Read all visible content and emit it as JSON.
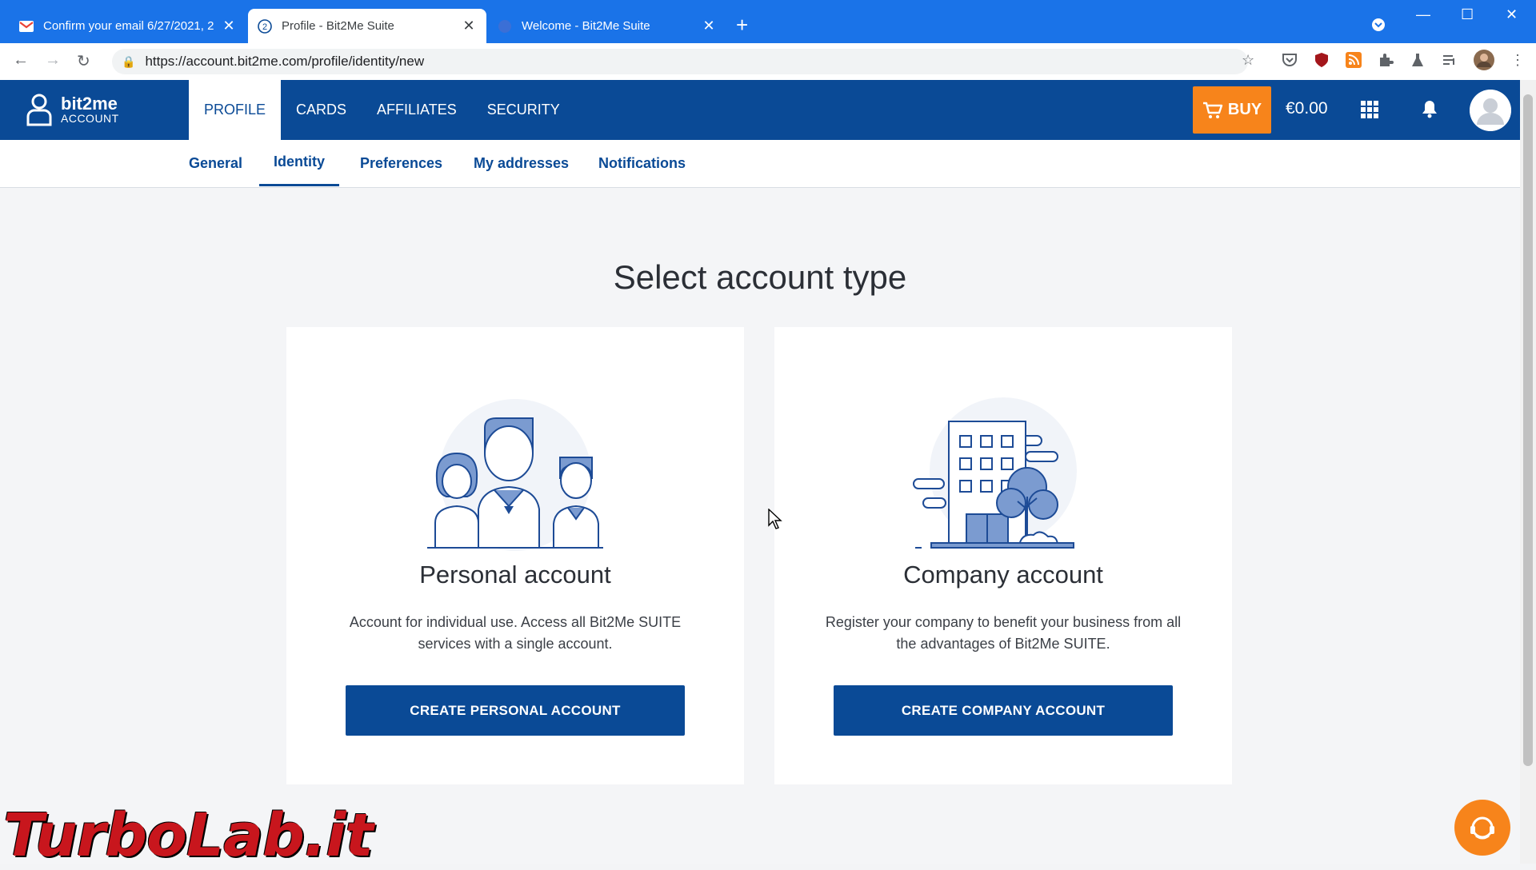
{
  "browser": {
    "tabs": [
      {
        "title": "Confirm your email 6/27/2021, 2",
        "favicon": "gmail-icon"
      },
      {
        "title": "Profile - Bit2Me Suite",
        "favicon": "bit2me-icon"
      },
      {
        "title": "Welcome - Bit2Me Suite",
        "favicon": "bit2me-icon"
      }
    ],
    "url": "https://account.bit2me.com/profile/identity/new"
  },
  "header": {
    "logo_name": "bit2me",
    "logo_sub": "ACCOUNT",
    "nav": [
      "PROFILE",
      "CARDS",
      "AFFILIATES",
      "SECURITY"
    ],
    "buy_label": "BUY",
    "balance": "€0.00"
  },
  "subnav": [
    "General",
    "Identity",
    "Preferences",
    "My addresses",
    "Notifications"
  ],
  "main": {
    "title": "Select account type",
    "cards": [
      {
        "title": "Personal account",
        "description": "Account for individual use. Access all Bit2Me SUITE services with a single account.",
        "button": "CREATE PERSONAL ACCOUNT"
      },
      {
        "title": "Company account",
        "description": "Register your company to benefit your business from all the advantages of Bit2Me SUITE.",
        "button": "CREATE COMPANY ACCOUNT"
      }
    ]
  },
  "watermark": "TurboLab.it",
  "colors": {
    "primary": "#0a4a96",
    "accent": "#f7841b",
    "chrome": "#1a73e8"
  }
}
